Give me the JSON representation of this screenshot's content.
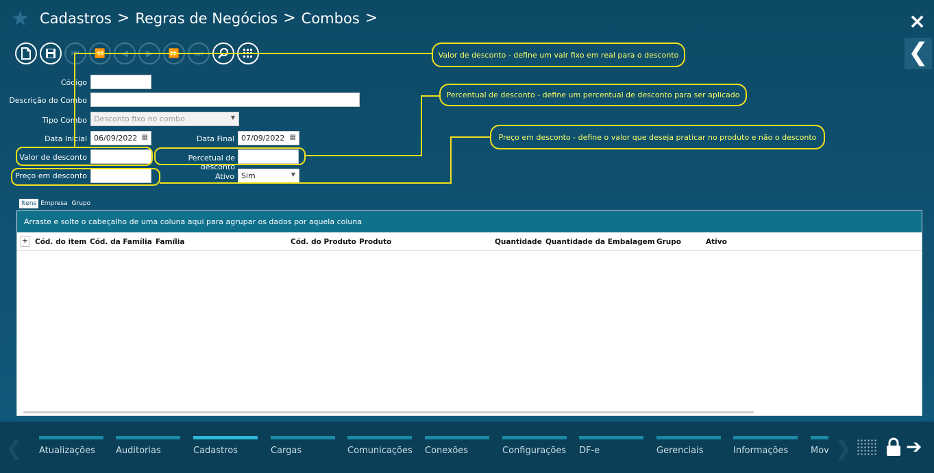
{
  "breadcrumb": [
    "Cadastros",
    "Regras de Negócios",
    "Combos"
  ],
  "breadcrumb_sep": ">",
  "close_icon": "×",
  "side_icon": "❮",
  "toolbar": {
    "new": "new-document-icon",
    "save": "save-icon",
    "first": "first-icon",
    "prev_page": "prev-page-icon",
    "prev": "prev-icon",
    "next": "next-icon",
    "next_page": "next-page-icon",
    "last": "last-icon",
    "search": "search-icon",
    "grid": "grid-icon"
  },
  "form": {
    "codigo_label": "Código",
    "descricao_label": "Descrição do Combo",
    "tipo_label": "Tipo Combo",
    "tipo_value": "Desconto fixo no combo",
    "data_inicial_label": "Data Inicial",
    "data_inicial_value": "06/09/2022",
    "data_final_label": "Data Final",
    "data_final_value": "07/09/2022",
    "valor_desconto_label": "Valor de desconto",
    "percentual_label": "Percetual de desconto",
    "preco_label": "Preço em desconto",
    "ativo_label": "Ativo",
    "ativo_value": "Sim"
  },
  "callouts": {
    "valor": "Valor de desconto - define um valr fixo em real para o desconto",
    "percentual": "Percentual de desconto - define um percentual de desconto para ser aplicado",
    "preco": "Preço em desconto - define o valor que deseja praticar no produto e não o desconto"
  },
  "tabs": [
    "Itens",
    "Empresa",
    "Grupo"
  ],
  "grid": {
    "group_hint": "Arraste e solte o cabeçalho de uma coluna aqui para agrupar os dados por aquela coluna",
    "plus": "+",
    "columns": [
      "Cód. do item",
      "Cód. da Família",
      "Família",
      "Cód. do Produto",
      "Produto",
      "Quantidade",
      "Quantidade da Embalagem",
      "Grupo",
      "Ativo"
    ]
  },
  "bottom_nav": [
    "Atualizações",
    "Auditorias",
    "Cadastros",
    "Cargas",
    "Comunicações",
    "Conexões",
    "Configurações",
    "DF-e",
    "Gerenciais",
    "Informações",
    "Mov"
  ],
  "bottom_active": "Cadastros",
  "colors": {
    "background": "#0f4f6c",
    "accent": "#2fb7d5",
    "callout": "#f2e01c"
  }
}
